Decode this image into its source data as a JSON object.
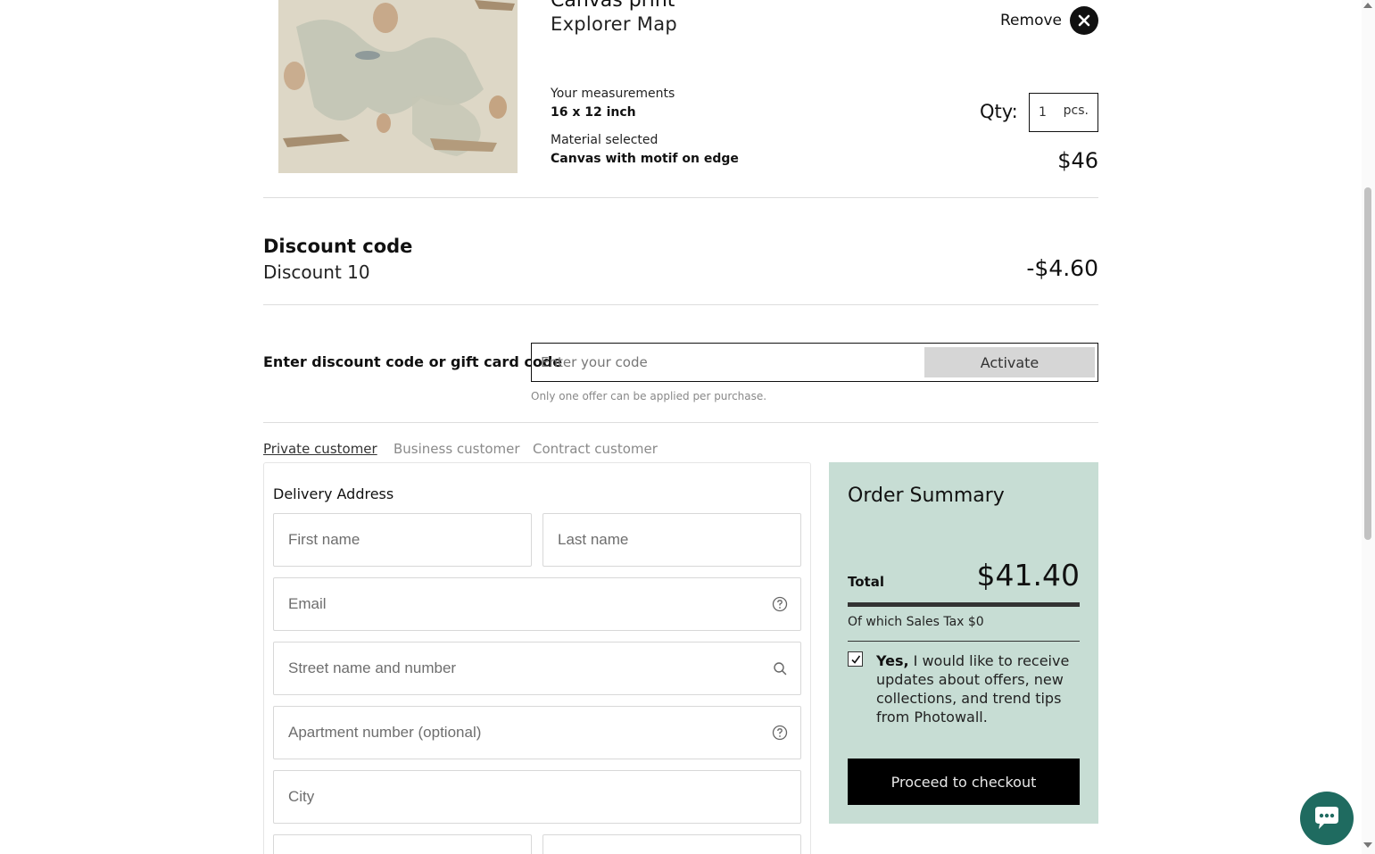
{
  "product": {
    "title": "Canvas print",
    "subtitle": "Explorer Map",
    "measurements_label": "Your measurements",
    "measurements_value": "16 x 12 inch",
    "material_label": "Material selected",
    "material_value": "Canvas with motif on edge",
    "remove_label": "Remove",
    "qty_label": "Qty:",
    "qty_value": "1",
    "qty_unit": "pcs.",
    "price": "$46"
  },
  "discount": {
    "title": "Discount code",
    "name": "Discount 10",
    "amount": "-$4.60",
    "code_label": "Enter discount code or gift card code",
    "code_placeholder": "Enter your code",
    "activate_label": "Activate",
    "note": "Only one offer can be applied per purchase."
  },
  "customer_tabs": [
    {
      "label": "Private customer",
      "active": true
    },
    {
      "label": "Business customer",
      "active": false
    },
    {
      "label": "Contract customer",
      "active": false
    }
  ],
  "delivery": {
    "title": "Delivery Address",
    "first_name_placeholder": "First name",
    "last_name_placeholder": "Last name",
    "email_placeholder": "Email",
    "street_placeholder": "Street name and number",
    "apartment_placeholder": "Apartment number (optional)",
    "city_placeholder": "City"
  },
  "summary": {
    "title": "Order Summary",
    "total_label": "Total",
    "total_value": "$41.40",
    "tax_text": "Of which Sales Tax $0",
    "consent_bold": "Yes,",
    "consent_text": " I would like to receive updates about offers, new collections, and trend tips from Photowall.",
    "consent_checked": true,
    "checkout_label": "Proceed to checkout"
  },
  "colors": {
    "summary_bg": "#c7ddd4",
    "chat_bg": "#1f6b60",
    "checkout_bg": "#000000"
  }
}
